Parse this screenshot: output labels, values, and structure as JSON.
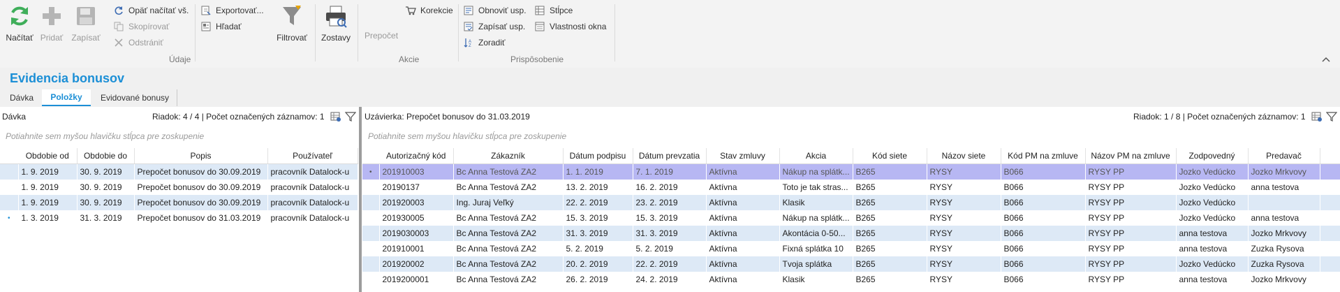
{
  "ribbon": {
    "buttons": {
      "reload": "Načítať",
      "add": "Pridať",
      "save": "Zapísať",
      "reread": "Opäť načítať vš.",
      "copy": "Skopírovať",
      "remove": "Odstrániť",
      "export": "Exportovať...",
      "find": "Hľadať",
      "filter": "Filtrovať",
      "reports": "Zostavy",
      "recalc": "Prepočet",
      "corrections": "Korekcie",
      "refresh_layout": "Obnoviť usp.",
      "save_layout": "Zapísať usp.",
      "sort": "Zoradiť",
      "columns": "Stĺpce",
      "window_props": "Vlastnosti okna"
    },
    "groups": {
      "data": "Údaje",
      "actions": "Akcie",
      "customize": "Prispôsobenie"
    }
  },
  "page": {
    "title": "Evidencia bonusov",
    "tabs": [
      "Dávka",
      "Položky",
      "Evidované bonusy"
    ],
    "active_tab": 1
  },
  "left_panel": {
    "title": "Dávka",
    "row_info": "Riadok: 4 / 4 | Počet označených záznamov: 1",
    "group_hint": "Potiahnite sem myšou hlavičku stĺpca pre zoskupenie",
    "columns": [
      "Obdobie od",
      "Obdobie do",
      "Popis",
      "Používateľ"
    ],
    "rows": [
      [
        "1. 9. 2019",
        "30. 9. 2019",
        "Prepočet bonusov do 30.09.2019",
        "pracovník Datalock-u"
      ],
      [
        "1. 9. 2019",
        "30. 9. 2019",
        "Prepočet bonusov do 30.09.2019",
        "pracovník Datalock-u"
      ],
      [
        "1. 9. 2019",
        "30. 9. 2019",
        "Prepočet bonusov do 30.09.2019",
        "pracovník Datalock-u"
      ],
      [
        "1. 3. 2019",
        "31. 3. 2019",
        "Prepočet bonusov do 31.03.2019",
        "pracovník Datalock-u"
      ]
    ],
    "current_row": 3,
    "current_marker": "•"
  },
  "right_panel": {
    "title": "Uzávierka: Prepočet bonusov do 31.03.2019",
    "row_info": "Riadok: 1 / 8 | Počet označených záznamov: 1",
    "group_hint": "Potiahnite sem myšou hlavičku stĺpca pre zoskupenie",
    "columns": [
      "Autorizačný kód",
      "Zákazník",
      "Dátum podpisu",
      "Dátum prevzatia",
      "Stav zmluvy",
      "Akcia",
      "Kód siete",
      "Názov siete",
      "Kód PM na zmluve",
      "Názov PM na zmluve",
      "Zodpovedný",
      "Predavač"
    ],
    "rows": [
      [
        "201910003",
        "Bc Anna  Testová ZA2",
        "1. 1. 2019",
        "7. 1. 2019",
        "Aktívna",
        "Nákup na splátk...",
        "B265",
        "RYSY",
        "B066",
        "RYSY PP",
        "Jozko Vedúcko",
        "Jozko Mrkvovy"
      ],
      [
        "20190137",
        "Bc Anna  Testová ZA2",
        "13. 2. 2019",
        "16. 2. 2019",
        "Aktívna",
        "Toto je tak stras...",
        "B265",
        "RYSY",
        "B066",
        "RYSY PP",
        "Jozko Vedúcko",
        "anna testova"
      ],
      [
        "201920003",
        "Ing. Juraj Veľký",
        "22. 2. 2019",
        "23. 2. 2019",
        "Aktívna",
        "Klasik",
        "B265",
        "RYSY",
        "B066",
        "RYSY PP",
        "Jozko Vedúcko",
        ""
      ],
      [
        "201930005",
        "Bc Anna  Testová ZA2",
        "15. 3. 2019",
        "15. 3. 2019",
        "Aktívna",
        "Nákup na splátk...",
        "B265",
        "RYSY",
        "B066",
        "RYSY PP",
        "Jozko Vedúcko",
        "anna testova"
      ],
      [
        "2019030003",
        "Bc Anna  Testová ZA2",
        "31. 3. 2019",
        "31. 3. 2019",
        "Aktívna",
        "Akontácia 0-50...",
        "B265",
        "RYSY",
        "B066",
        "RYSY PP",
        "anna testova",
        "Jozko Mrkvovy"
      ],
      [
        "201910001",
        "Bc Anna  Testová ZA2",
        "5. 2. 2019",
        "5. 2. 2019",
        "Aktívna",
        "Fixná splátka 10",
        "B265",
        "RYSY",
        "B066",
        "RYSY PP",
        "anna testova",
        "Zuzka Rysova"
      ],
      [
        "201920002",
        "Bc Anna  Testová ZA2",
        "20. 2. 2019",
        "22. 2. 2019",
        "Aktívna",
        "Tvoja splátka",
        "B265",
        "RYSY",
        "B066",
        "RYSY PP",
        "Jozko Vedúcko",
        "Zuzka Rysova"
      ],
      [
        "2019200001",
        "Bc Anna  Testová ZA2",
        "26. 2. 2019",
        "24. 2. 2019",
        "Aktívna",
        "Klasik",
        "B265",
        "RYSY",
        "B066",
        "RYSY PP",
        "anna testova",
        "Jozko Mrkvovy"
      ]
    ],
    "current_row": 0,
    "current_marker": "•"
  },
  "colors": {
    "accent": "#1c8fd6",
    "row_alt": "#dde9f6",
    "row_selected": "#b7b7f3"
  }
}
